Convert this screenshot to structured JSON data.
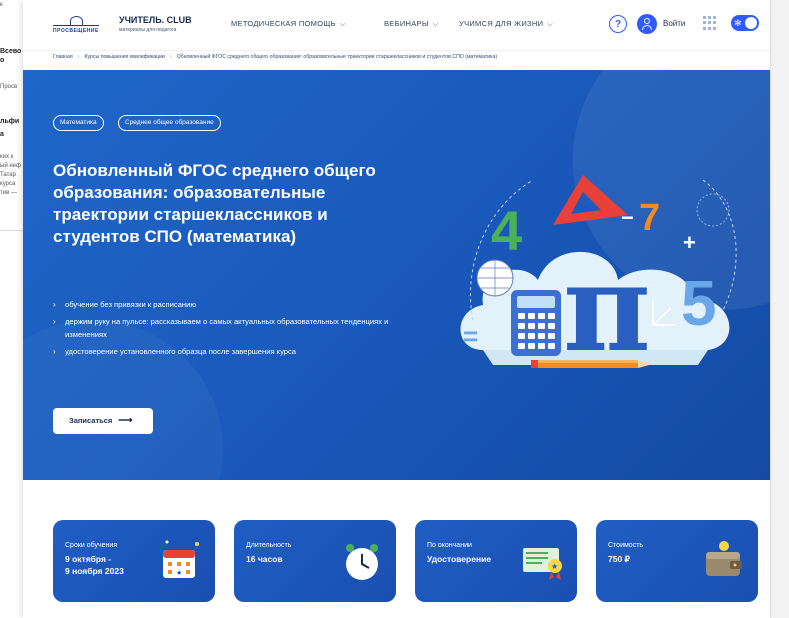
{
  "background_window": {
    "fragments": [
      "к",
      "Всево",
      "о",
      "Просв",
      "льфи",
      "а",
      "ких к",
      "ый неф",
      "Татар",
      "курса",
      "тив —"
    ]
  },
  "header": {
    "logo_text": "ПРОСВЕЩЕНИЕ",
    "brand_title": "УЧИТЕЛЬ. CLUB",
    "brand_sub": "материалы для педагога",
    "nav": [
      {
        "label": "МЕТОДИЧЕСКАЯ ПОМОЩЬ"
      },
      {
        "label": "ВЕБИНАРЫ"
      },
      {
        "label": "УЧИМСЯ ДЛЯ ЖИЗНИ"
      }
    ],
    "help_label": "?",
    "login_label": "Войти"
  },
  "breadcrumb": {
    "home": "Главная",
    "courses": "Курсы повышения квалификации",
    "current": "Обновленный ФГОС среднего общего образования: образовательные траектории старшеклассников и студентов СПО (математика)"
  },
  "hero": {
    "tags": [
      "Математика",
      "Среднее общее образование"
    ],
    "title": "Обновленный ФГОС среднего общего образования: образовательные траектории старшеклассников и студентов СПО (математика)",
    "bullets": [
      "обучение без привязки к расписанию",
      "держим руку на пульсе: рассказываем о самых актуальных образовательных тенденциях и изменениях",
      "удостоверение установленного образца после завершения курса"
    ],
    "cta_label": "Записаться",
    "illustration": {
      "numbers": [
        "4",
        "7",
        "5"
      ],
      "pi": "π",
      "plus": "+",
      "minus": "−",
      "equals": "="
    }
  },
  "cards": [
    {
      "label": "Сроки обучения",
      "value": "9 октября -\n9 ноября 2023",
      "icon": "calendar-icon"
    },
    {
      "label": "Длительность",
      "value": "16 часов",
      "icon": "clock-icon"
    },
    {
      "label": "По окончании",
      "value": "Удостоверение",
      "icon": "certificate-icon"
    },
    {
      "label": "Стоимость",
      "value": "750 ₽",
      "icon": "wallet-icon"
    }
  ],
  "colors": {
    "accent": "#2e5bff",
    "hero_blue": "#1a5bbd",
    "card_blue": "#1f5ec4",
    "red": "#e8413a",
    "orange": "#f28b22",
    "green": "#4caf50"
  }
}
